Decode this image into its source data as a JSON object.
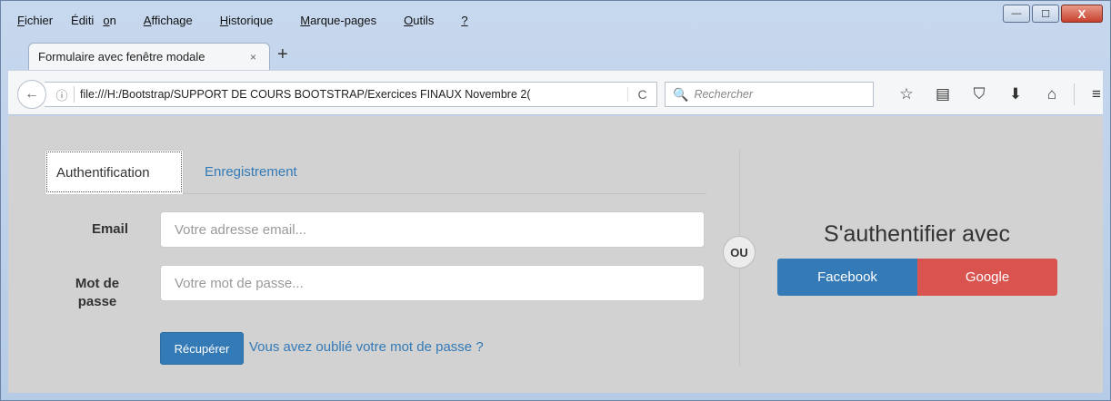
{
  "menu": [
    {
      "pre": "",
      "key": "F",
      "post": "ichier"
    },
    {
      "pre": "Éditi",
      "key": "o",
      "post": "n"
    },
    {
      "pre": "",
      "key": "A",
      "post": "ffichage"
    },
    {
      "pre": "",
      "key": "H",
      "post": "istorique"
    },
    {
      "pre": "",
      "key": "M",
      "post": "arque-pages"
    },
    {
      "pre": "",
      "key": "O",
      "post": "utils"
    },
    {
      "pre": "",
      "key": "?",
      "post": ""
    }
  ],
  "window_controls": {
    "minimize": "—",
    "maximize": "☐",
    "close": "X"
  },
  "browser_tab": {
    "title": "Formulaire avec fenêtre modale",
    "close": "×",
    "new_tab": "+"
  },
  "navbar": {
    "back": "←",
    "info": "ⓘ",
    "url": "file:///H:/Bootstrap/SUPPORT DE COURS BOOTSTRAP/Exercices FINAUX Novembre 2(",
    "reload": "C",
    "search_icon": "🔍",
    "search_placeholder": "Rechercher",
    "icons": [
      "☆",
      "▤",
      "⛉",
      "⬇",
      "⌂",
      "≡"
    ]
  },
  "page": {
    "tabs": [
      "Authentification",
      "Enregistrement"
    ],
    "email_label": "Email",
    "email_placeholder": "Votre adresse email...",
    "password_label_1": "Mot de",
    "password_label_2": "passe",
    "password_placeholder": "Votre mot de passe...",
    "recover_button": "Récupérer",
    "forgot_link": "Vous avez oublié votre mot de passe ?",
    "or_label": "OU",
    "auth_title": "S'authentifier avec",
    "facebook": "Facebook",
    "google": "Google"
  },
  "colors": {
    "primary": "#337ab7",
    "danger": "#d9534f",
    "content_bg": "#d2d2d2"
  }
}
